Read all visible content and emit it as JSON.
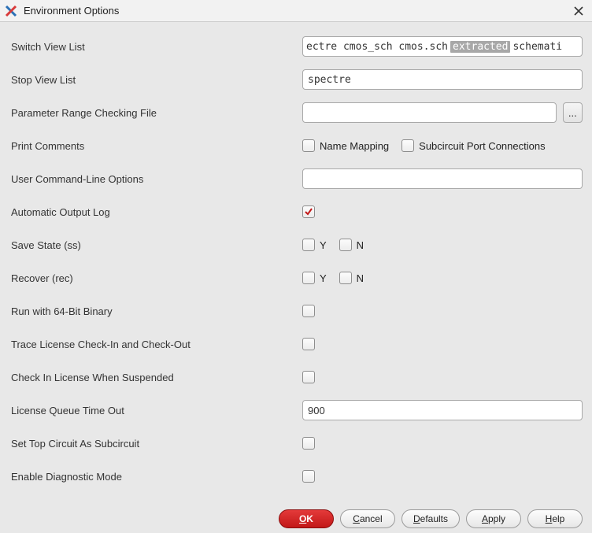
{
  "window": {
    "title": "Environment Options"
  },
  "rows": {
    "switchViewList": {
      "label": "Switch View List",
      "pre": "ectre cmos_sch cmos.sch ",
      "highlight": "extracted",
      "post": " schemati"
    },
    "stopViewList": {
      "label": "Stop View List",
      "value": "spectre"
    },
    "paramRange": {
      "label": "Parameter Range Checking File",
      "value": "",
      "browse": "..."
    },
    "printComments": {
      "label": "Print Comments",
      "nameMapping": "Name Mapping",
      "subcircuit": "Subcircuit Port Connections"
    },
    "userCmd": {
      "label": "User Command-Line Options",
      "value": ""
    },
    "autoLog": {
      "label": "Automatic Output Log"
    },
    "saveState": {
      "label": "Save State (ss)",
      "y": "Y",
      "n": "N"
    },
    "recover": {
      "label": "Recover (rec)",
      "y": "Y",
      "n": "N"
    },
    "run64": {
      "label": "Run with 64-Bit Binary"
    },
    "traceLicense": {
      "label": "Trace License Check-In and Check-Out"
    },
    "checkInSuspended": {
      "label": "Check In License When Suspended"
    },
    "licenseQueue": {
      "label": "License Queue Time Out",
      "value": "900"
    },
    "topCircuit": {
      "label": "Set Top Circuit As Subcircuit"
    },
    "diagnostic": {
      "label": "Enable Diagnostic Mode"
    }
  },
  "buttons": {
    "ok": "OK",
    "cancel": "Cancel",
    "defaults": "Defaults",
    "apply": "Apply",
    "help": "Help"
  }
}
